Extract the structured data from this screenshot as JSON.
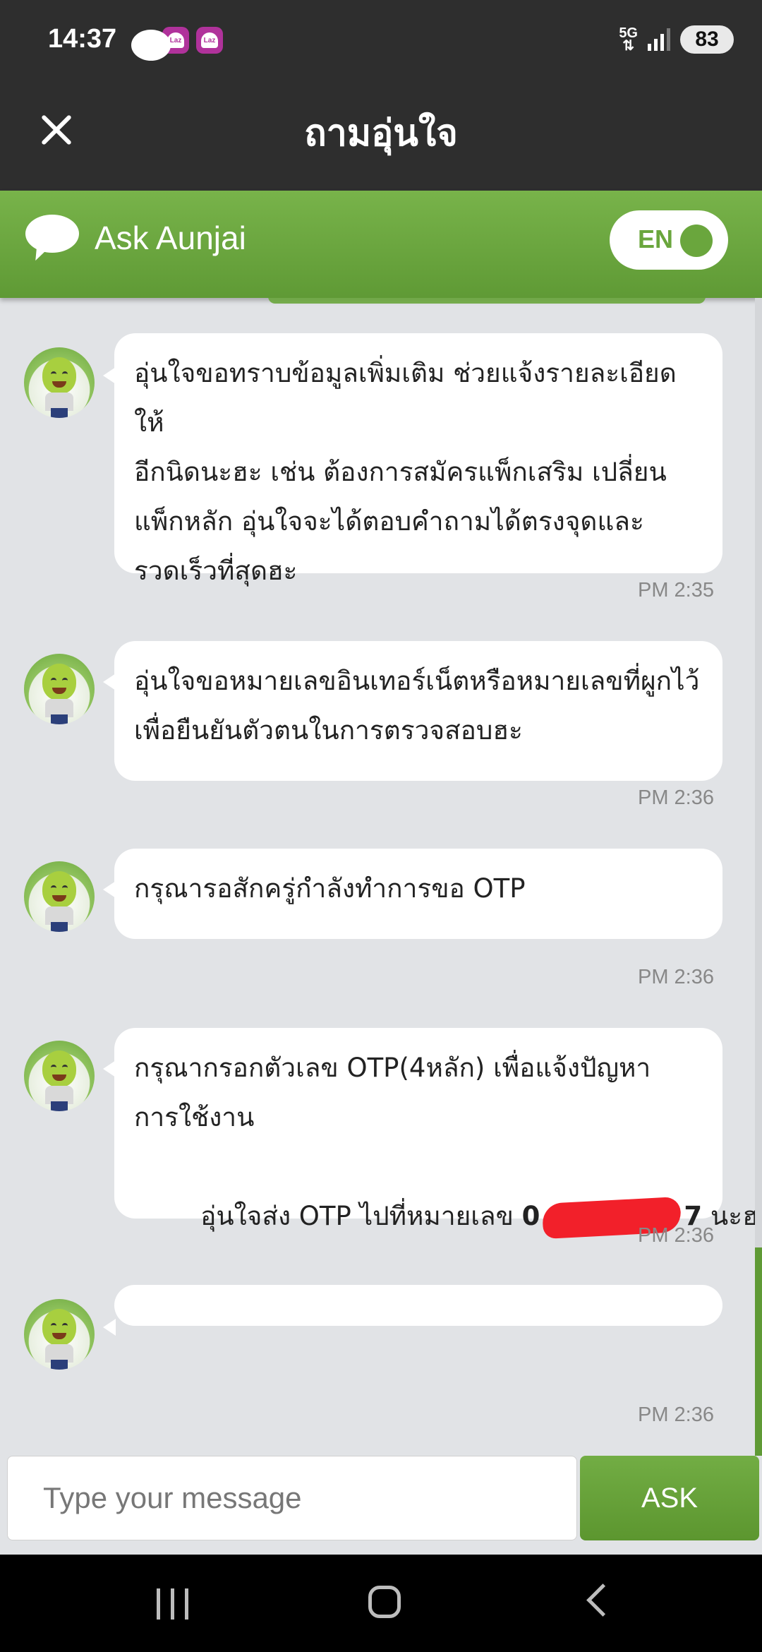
{
  "status_bar": {
    "time": "14:37",
    "network": "5G",
    "battery": "83"
  },
  "header": {
    "title": "ถามอุ่นใจ"
  },
  "chat_header": {
    "title": "Ask Aunjai",
    "lang_toggle": "EN"
  },
  "messages": [
    {
      "text": "อุ่นใจขอทราบข้อมูลเพิ่มเติม ช่วยแจ้งรายละเอียดให้\nอีกนิดนะฮะ เช่น ต้องการสมัครแพ็กเสริม เปลี่ยน\nแพ็กหลัก อุ่นใจจะได้ตอบคำถามได้ตรงจุดและ\nรวดเร็วที่สุดฮะ",
      "time": "PM 2:35"
    },
    {
      "text": "อุ่นใจขอหมายเลขอินเทอร์เน็ตหรือหมายเลขที่ผูกไว้\nเพื่อยืนยันตัวตนในการตรวจสอบฮะ",
      "time": "PM 2:36"
    },
    {
      "text": "กรุณารอสักครู่กำลังทำการขอ OTP",
      "time": "PM 2:36"
    },
    {
      "text_lines": [
        "กรุณากรอกตัวเลข OTP(4หลัก) เพื่อแจ้งปัญหา",
        "การใช้งาน"
      ],
      "line3_prefix": "อุ่นใจส่ง OTP ไปที่หมายเลข ",
      "phone_start": "0",
      "phone_end": "7",
      "line3_suffix": " นะฮะ",
      "time": "PM 2:36"
    },
    {
      "text": "",
      "time": "PM 2:36"
    }
  ],
  "input": {
    "placeholder": "Type your message",
    "button": "ASK"
  }
}
